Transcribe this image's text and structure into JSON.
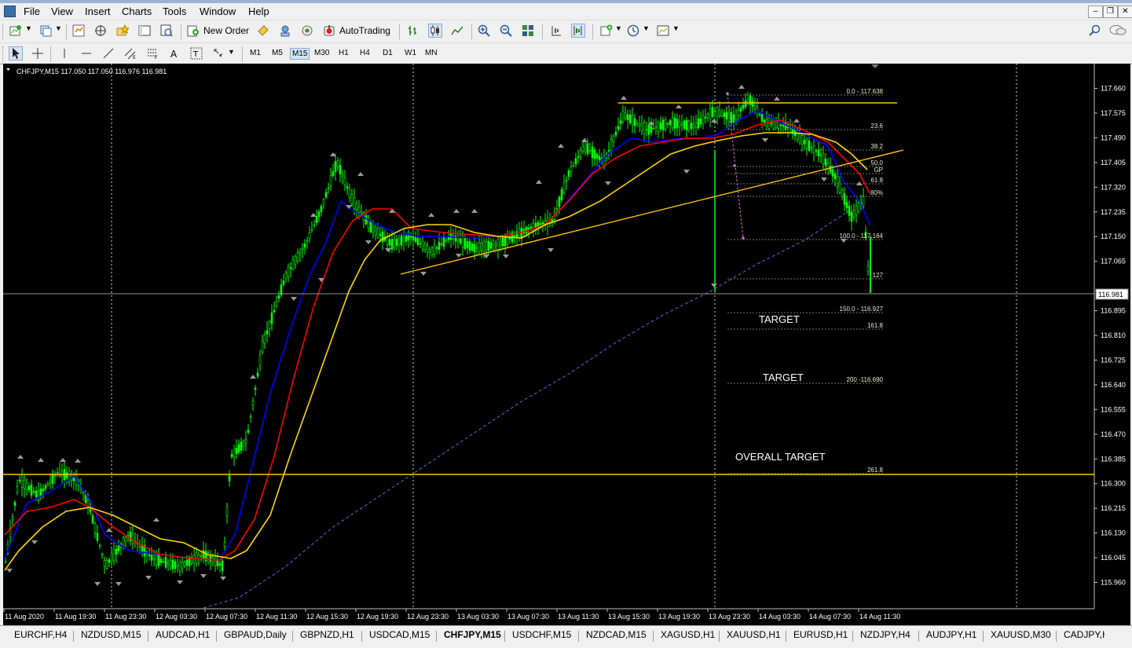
{
  "menu": {
    "items": [
      "File",
      "View",
      "Insert",
      "Charts",
      "Tools",
      "Window",
      "Help"
    ]
  },
  "toolbar": {
    "new_order": "New Order",
    "autotrading": "AutoTrading"
  },
  "timeframes": [
    "M1",
    "M5",
    "M15",
    "M30",
    "H1",
    "H4",
    "D1",
    "W1",
    "MN"
  ],
  "active_timeframe": "M15",
  "chart": {
    "header": "CHFJPY,M15  117.050 117.050 116.976 116.981",
    "current_price": "116.981",
    "price_labels": [
      "117.660",
      "117.575",
      "117.490",
      "117.405",
      "117.320",
      "117.235",
      "117.150",
      "117.065",
      "116.895",
      "116.810",
      "116.725",
      "116.640",
      "116.555",
      "116.470",
      "116.385",
      "116.300",
      "116.215",
      "116.130",
      "116.045",
      "115.960"
    ],
    "time_labels": [
      "11 Aug 2020",
      "11 Aug 19:30",
      "11 Aug 23:30",
      "12 Aug 03:30",
      "12 Aug 07:30",
      "12 Aug 11:30",
      "12 Aug 15:30",
      "12 Aug 19:30",
      "12 Aug 23:30",
      "13 Aug 03:30",
      "13 Aug 07:30",
      "13 Aug 11:30",
      "13 Aug 15:30",
      "13 Aug 19:30",
      "13 Aug 23:30",
      "14 Aug 03:30",
      "14 Aug 07:30",
      "14 Aug 11:30"
    ],
    "fib_labels": [
      "0.0 - 117.638",
      "23.6",
      "38.2",
      "50.0",
      "GP",
      "61.8",
      "80%",
      "100.0 - 117.164",
      "127",
      "150.0 - 116.927",
      "161.8",
      "200 -116.690",
      "261.8"
    ],
    "annotations": [
      "TARGET",
      "TARGET",
      "OVERALL TARGET"
    ],
    "colors": {
      "background": "#000000",
      "bull_candles": "#00ff00",
      "ma_fast": "#0000ff",
      "ma_mid": "#ff0000",
      "ma_slow": "#ffd700",
      "ma_long": "#4f6fdf",
      "levels": "#ffc300"
    }
  },
  "symbol_tabs": [
    "EURCHF,H4",
    "NZDUSD,M15",
    "AUDCAD,H1",
    "GBPAUD,Daily",
    "GBPNZD,H1",
    "USDCAD,M15",
    "CHFJPY,M15",
    "USDCHF,M15",
    "NZDCAD,M15",
    "XAGUSD,H1",
    "XAUUSD,H1",
    "EURUSD,H1",
    "NZDJPY,H4",
    "AUDJPY,H1",
    "XAUUSD,M30",
    "CADJPY,H"
  ]
}
